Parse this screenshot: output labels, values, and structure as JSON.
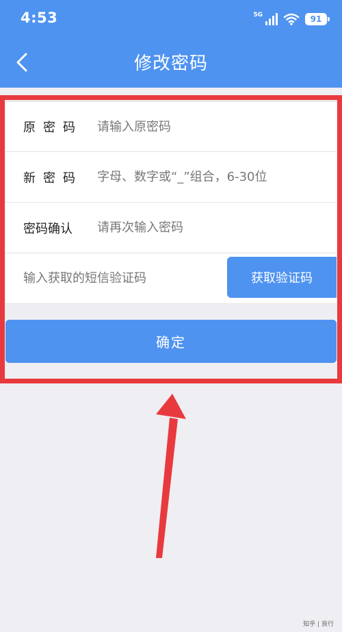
{
  "status_bar": {
    "time": "4:53",
    "network": "5G",
    "battery": "91"
  },
  "header": {
    "title": "修改密码",
    "back_icon": "chevron-left-icon"
  },
  "form": {
    "old_password": {
      "label": "原密码",
      "placeholder": "请输入原密码",
      "value": ""
    },
    "new_password": {
      "label": "新密码",
      "placeholder": "字母、数字或“_”组合，6-30位",
      "value": ""
    },
    "confirm_password": {
      "label": "密码确认",
      "placeholder": "请再次输入密码",
      "value": ""
    },
    "sms_code": {
      "placeholder": "输入获取的短信验证码",
      "value": "",
      "button_label": "获取验证码"
    }
  },
  "confirm_button_label": "确定",
  "annotation": {
    "box_color": "#e83a3e",
    "arrow_color": "#e83a3e"
  },
  "colors": {
    "accent": "#4f93f0",
    "background": "#efeef3"
  },
  "watermark": "知乎 | 良行"
}
